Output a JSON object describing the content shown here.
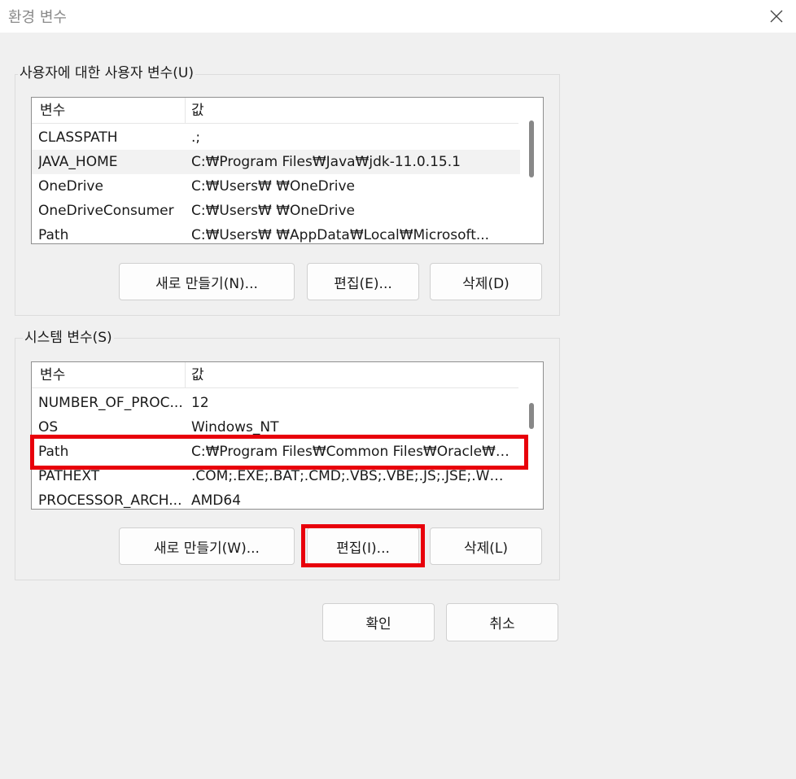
{
  "window": {
    "title": "환경 변수",
    "close_glyph": "✕"
  },
  "user_vars": {
    "label": "사용자에 대한 사용자 변수(U)",
    "col_name": "변수",
    "col_value": "값",
    "rows": [
      {
        "name": "CLASSPATH",
        "value": ".;"
      },
      {
        "name": "JAVA_HOME",
        "value": "C:₩Program Files₩Java₩jdk-11.0.15.1"
      },
      {
        "name": "OneDrive",
        "value": "C:₩Users₩           ₩OneDrive"
      },
      {
        "name": "OneDriveConsumer",
        "value": "C:₩Users₩           ₩OneDrive"
      },
      {
        "name": "Path",
        "value": "C:₩Users₩           ₩AppData₩Local₩Microsoft..."
      }
    ],
    "new_button": "새로 만들기(N)...",
    "edit_button": "편집(E)...",
    "delete_button": "삭제(D)"
  },
  "system_vars": {
    "label": "시스템 변수(S)",
    "col_name": "변수",
    "col_value": "값",
    "rows": [
      {
        "name": "NUMBER_OF_PROC...",
        "value": "12"
      },
      {
        "name": "OS",
        "value": "Windows_NT"
      },
      {
        "name": "Path",
        "value": "C:₩Program Files₩Common Files₩Oracle₩Ja..."
      },
      {
        "name": "PATHEXT",
        "value": ".COM;.EXE;.BAT;.CMD;.VBS;.VBE;.JS;.JSE;.WSF;...."
      },
      {
        "name": "PROCESSOR_ARCH...",
        "value": "AMD64"
      }
    ],
    "new_button": "새로 만들기(W)...",
    "edit_button": "편집(I)...",
    "delete_button": "삭제(L)"
  },
  "footer": {
    "ok_button": "확인",
    "cancel_button": "취소"
  },
  "colors": {
    "highlight": "#e8000b",
    "background": "#f0f0f0",
    "selected_row": "#f2f2f2"
  },
  "icons": {
    "close": "close-icon"
  }
}
